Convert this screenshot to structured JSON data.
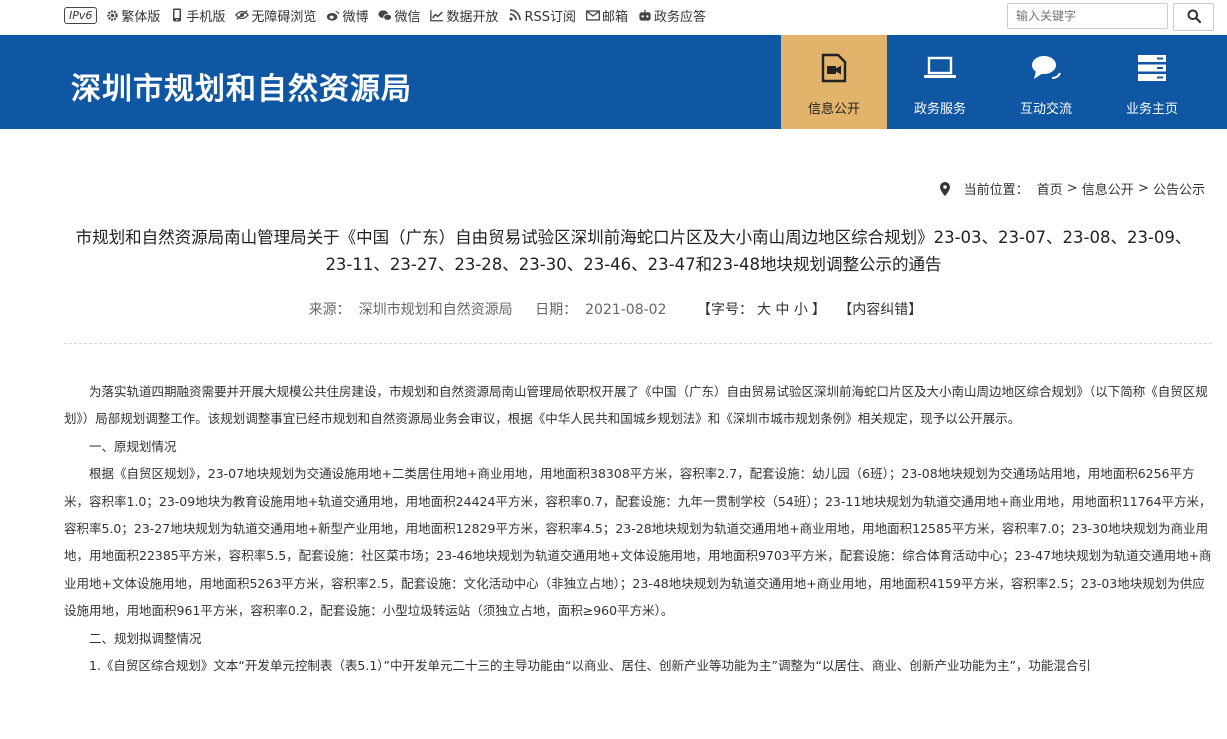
{
  "topbar": {
    "ipv6": "IPv6",
    "links": [
      {
        "label": "繁体版",
        "icon": "gear-icon"
      },
      {
        "label": "手机版",
        "icon": "mobile-icon"
      },
      {
        "label": "无障碍浏览",
        "icon": "eye-icon"
      },
      {
        "label": "微博",
        "icon": "weibo-icon"
      },
      {
        "label": "微信",
        "icon": "wechat-icon"
      },
      {
        "label": "数据开放",
        "icon": "chart-icon"
      },
      {
        "label": "RSS订阅",
        "icon": "rss-icon"
      },
      {
        "label": "邮箱",
        "icon": "mail-icon"
      },
      {
        "label": "政务应答",
        "icon": "robot-icon"
      }
    ],
    "search_placeholder": "输入关键字"
  },
  "header": {
    "site_title": "深圳市规划和自然资源局",
    "nav": [
      {
        "label": "信息公开",
        "icon": "video-doc-icon",
        "active": true
      },
      {
        "label": "政务服务",
        "icon": "laptop-icon",
        "active": false
      },
      {
        "label": "互动交流",
        "icon": "chat-icon",
        "active": false
      },
      {
        "label": "业务主页",
        "icon": "server-icon",
        "active": false
      }
    ],
    "colors": {
      "band": "#0f56a3",
      "active": "#e2b36a"
    }
  },
  "breadcrumb": {
    "prefix": "当前位置：",
    "items": [
      "首页",
      "信息公开",
      "公告公示"
    ],
    "separator": ">"
  },
  "article": {
    "title": "市规划和自然资源局南山管理局关于《中国（广东）自由贸易试验区深圳前海蛇口片区及大小南山周边地区综合规划》23-03、23-07、23-08、23-09、23-11、23-27、23-28、23-30、23-46、23-47和23-48地块规划调整公示的通告",
    "source_label": "来源：",
    "source_value": "深圳市规划和自然资源局",
    "date_label": "日期：",
    "date_value": "2021-08-02",
    "font_size_label": "【字号：",
    "size_large": "大",
    "size_medium": "中",
    "size_small": "小",
    "font_size_end": "】",
    "correction": "【内容纠错】",
    "paragraphs": [
      "为落实轨道四期融资需要并开展大规模公共住房建设，市规划和自然资源局南山管理局依职权开展了《中国（广东）自由贸易试验区深圳前海蛇口片区及大小南山周边地区综合规划》（以下简称《自贸区规划》）局部规划调整工作。该规划调整事宜已经市规划和自然资源局业务会审议，根据《中华人民共和国城乡规划法》和《深圳市城市规划条例》相关规定，现予以公开展示。",
      "一、原规划情况",
      "根据《自贸区规划》，23-07地块规划为交通设施用地+二类居住用地+商业用地，用地面积38308平方米，容积率2.7，配套设施：幼儿园（6班）；23-08地块规划为交通场站用地，用地面积6256平方米，容积率1.0；23-09地块为教育设施用地+轨道交通用地，用地面积24424平方米，容积率0.7，配套设施：九年一贯制学校（54班）；23-11地块规划为轨道交通用地+商业用地，用地面积11764平方米，容积率5.0；23-27地块规划为轨道交通用地+新型产业用地，用地面积12829平方米，容积率4.5；23-28地块规划为轨道交通用地+商业用地，用地面积12585平方米，容积率7.0；23-30地块规划为商业用地，用地面积22385平方米，容积率5.5，配套设施：社区菜市场；23-46地块规划为轨道交通用地+文体设施用地，用地面积9703平方米，配套设施：综合体育活动中心；23-47地块规划为轨道交通用地+商业用地+文体设施用地，用地面积5263平方米，容积率2.5，配套设施：文化活动中心（非独立占地）；23-48地块规划为轨道交通用地+商业用地，用地面积4159平方米，容积率2.5；23-03地块规划为供应设施用地，用地面积961平方米，容积率0.2，配套设施：小型垃圾转运站（须独立占地，面积≥960平方米）。",
      "二、规划拟调整情况",
      "1.《自贸区综合规划》文本“开发单元控制表（表5.1）”中开发单元二十三的主导功能由“以商业、居住、创新产业等功能为主”调整为“以居住、商业、创新产业功能为主”，功能混合引"
    ]
  }
}
